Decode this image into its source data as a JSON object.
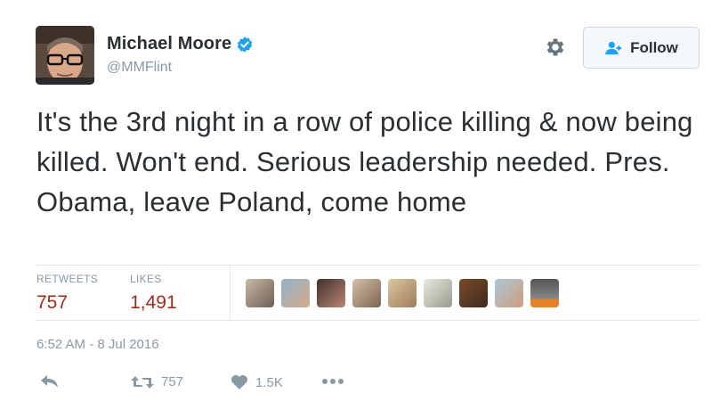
{
  "user": {
    "display_name": "Michael Moore",
    "handle": "@MMFlint",
    "verified": true,
    "avatar_icon": "user-avatar-photo"
  },
  "follow_button": {
    "label": "Follow",
    "icon": "follow-user-icon"
  },
  "settings_icon": "gear-icon",
  "tweet": {
    "text": "It's the 3rd night in a row of police killing & now being killed. Won't end. Serious leadership needed. Pres. Obama, leave Poland, come home"
  },
  "stats": {
    "retweets_label": "RETWEETS",
    "retweets_value": "757",
    "likes_label": "LIKES",
    "likes_value": "1,491"
  },
  "liked_by_count_shown": 9,
  "timestamp": "6:52 AM - 8 Jul 2016",
  "actions": {
    "reply_icon": "reply-icon",
    "retweet_count": "757",
    "like_count": "1.5K",
    "more_icon": "more-dots-icon"
  },
  "colors": {
    "text": "#292f33",
    "muted": "#8899a6",
    "stat_value": "#9d2d1a",
    "verified": "#1da1f2",
    "border": "#e1e8ed"
  }
}
